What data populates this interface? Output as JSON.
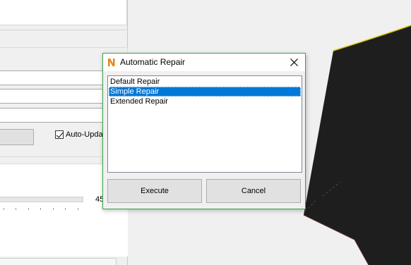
{
  "panel": {
    "auto_update_label": "Auto-Upda",
    "auto_update_checked": true,
    "slider_value": "45"
  },
  "dialog": {
    "title": "Automatic Repair",
    "list_items": [
      {
        "label": "Default Repair",
        "selected": false
      },
      {
        "label": "Simple Repair",
        "selected": true
      },
      {
        "label": "Extended Repair",
        "selected": false
      }
    ],
    "execute_label": "Execute",
    "cancel_label": "Cancel"
  },
  "icons": {
    "app": "netfabb-logo-icon",
    "close": "close-icon"
  },
  "colors": {
    "dialog_border": "#3aa34a",
    "selection": "#0078d7",
    "model_fill": "#1e1e1e",
    "model_edge": "#d4c600",
    "logo_orange": "#e8861c"
  }
}
